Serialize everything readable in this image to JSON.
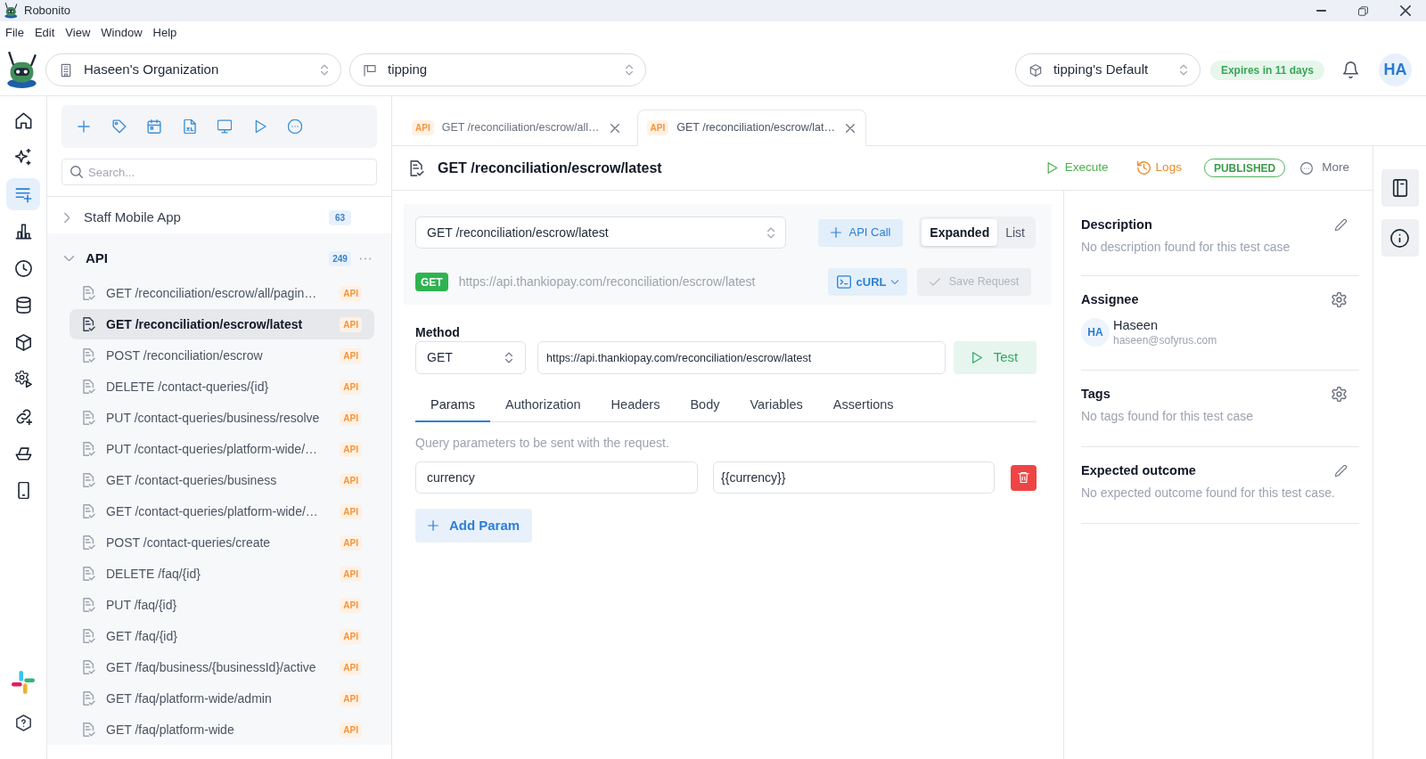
{
  "window": {
    "title": "Robonito"
  },
  "menu": [
    "File",
    "Edit",
    "View",
    "Window",
    "Help"
  ],
  "header": {
    "organization": "Haseen's Organization",
    "project": "tipping",
    "environment": "tipping's Default",
    "expiry": "Expires in 11 days",
    "avatar": "HA"
  },
  "nav_rail": {
    "items": [
      {
        "selected": false
      },
      {
        "selected": false
      },
      {
        "selected": true
      },
      {
        "selected": false
      },
      {
        "selected": false
      },
      {
        "selected": false
      },
      {
        "selected": false
      },
      {
        "selected": false
      },
      {
        "selected": false
      },
      {
        "selected": false
      },
      {
        "selected": false
      }
    ]
  },
  "tree": {
    "search": {
      "placeholder": "Search..."
    },
    "groups": [
      {
        "name": "Staff Mobile App",
        "count": "63",
        "expanded": false
      },
      {
        "name": "API",
        "count": "249",
        "expanded": true,
        "children": [
          {
            "label": "GET /reconciliation/escrow/all/pagin…",
            "badge": "API",
            "selected": false
          },
          {
            "label": "GET /reconciliation/escrow/latest",
            "badge": "API",
            "selected": true
          },
          {
            "label": "POST /reconciliation/escrow",
            "badge": "API",
            "selected": false
          },
          {
            "label": "DELETE /contact-queries/{id}",
            "badge": "API",
            "selected": false
          },
          {
            "label": "PUT /contact-queries/business/resolve",
            "badge": "API",
            "selected": false
          },
          {
            "label": "PUT /contact-queries/platform-wide/…",
            "badge": "API",
            "selected": false
          },
          {
            "label": "GET /contact-queries/business",
            "badge": "API",
            "selected": false
          },
          {
            "label": "GET /contact-queries/platform-wide/…",
            "badge": "API",
            "selected": false
          },
          {
            "label": "POST /contact-queries/create",
            "badge": "API",
            "selected": false
          },
          {
            "label": "DELETE /faq/{id}",
            "badge": "API",
            "selected": false
          },
          {
            "label": "PUT /faq/{id}",
            "badge": "API",
            "selected": false
          },
          {
            "label": "GET /faq/{id}",
            "badge": "API",
            "selected": false
          },
          {
            "label": "GET /faq/business/{businessId}/active",
            "badge": "API",
            "selected": false
          },
          {
            "label": "GET /faq/platform-wide/admin",
            "badge": "API",
            "selected": false
          },
          {
            "label": "GET /faq/platform-wide",
            "badge": "API",
            "selected": false
          }
        ]
      }
    ]
  },
  "tabs": [
    {
      "badge": "API",
      "label": "GET /reconciliation/escrow/all…",
      "selected": false
    },
    {
      "badge": "API",
      "label": "GET /reconciliation/escrow/lat…",
      "selected": true
    }
  ],
  "request": {
    "title": "GET /reconciliation/escrow/latest",
    "execute": "Execute",
    "logs": "Logs",
    "status": "PUBLISHED",
    "more": "More"
  },
  "request_bar": {
    "selected_request": "GET /reconciliation/escrow/latest",
    "add_button": "API Call",
    "view_modes": [
      {
        "label": "Expanded",
        "selected": true
      },
      {
        "label": "List",
        "selected": false
      }
    ],
    "method_badge": "GET",
    "url": "https://api.thankiopay.com/reconciliation/escrow/latest",
    "curl_button": "cURL",
    "save_button": {
      "label": "Save Request",
      "disabled": true
    }
  },
  "request_form": {
    "method_label": "Method",
    "method": "GET",
    "url": "https://api.thankiopay.com/reconciliation/escrow/latest",
    "test_button": "Test",
    "tabs": [
      {
        "label": "Params",
        "selected": true
      },
      {
        "label": "Authorization",
        "selected": false
      },
      {
        "label": "Headers",
        "selected": false
      },
      {
        "label": "Body",
        "selected": false
      },
      {
        "label": "Variables",
        "selected": false
      },
      {
        "label": "Assertions",
        "selected": false
      }
    ],
    "hint": "Query parameters to be sent with the request.",
    "params": [
      {
        "key": "currency",
        "value": "{{currency}}"
      }
    ],
    "add_param": "Add Param"
  },
  "details": {
    "sections": [
      {
        "title": "Description",
        "kind": "edit",
        "text": "No description found for this test case"
      },
      {
        "title": "Assignee",
        "kind": "settings",
        "assignee": {
          "initials": "HA",
          "name": "Haseen",
          "email": "haseen@sofyrus.com"
        }
      },
      {
        "title": "Tags",
        "kind": "settings",
        "text": "No tags found for this test case"
      },
      {
        "title": "Expected outcome",
        "kind": "edit",
        "text": "No expected outcome found for this test case."
      }
    ]
  }
}
